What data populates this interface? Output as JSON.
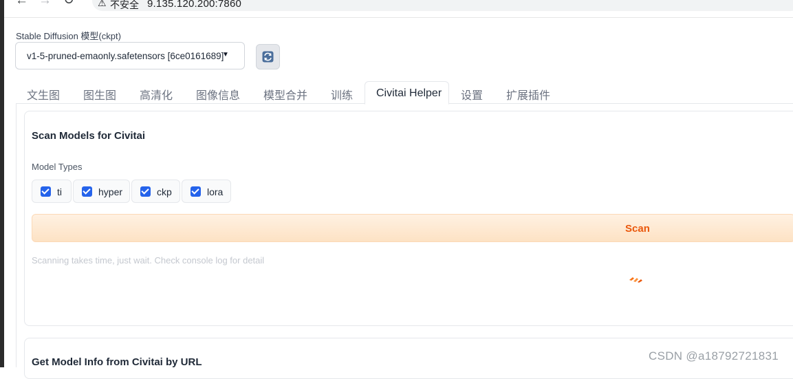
{
  "browser": {
    "security_label": "不安全",
    "url": "9.135.120.200:7860"
  },
  "checkpoint": {
    "label": "Stable Diffusion 模型(ckpt)",
    "value": "v1-5-pruned-emaonly.safetensors [6ce0161689]"
  },
  "tabs": [
    {
      "label": "文生图"
    },
    {
      "label": "图生图"
    },
    {
      "label": "高清化"
    },
    {
      "label": "图像信息"
    },
    {
      "label": "模型合并"
    },
    {
      "label": "训练"
    },
    {
      "label": "Civitai Helper",
      "active": true
    },
    {
      "label": "设置"
    },
    {
      "label": "扩展插件"
    }
  ],
  "scan_section": {
    "title": "Scan Models for Civitai",
    "types_label": "Model Types",
    "types": [
      {
        "label": "ti",
        "checked": true
      },
      {
        "label": "hyper",
        "checked": true
      },
      {
        "label": "ckp",
        "checked": true
      },
      {
        "label": "lora",
        "checked": true
      }
    ],
    "button_label": "Scan",
    "hint": "Scanning takes time, just wait. Check console log for detail"
  },
  "url_section": {
    "title": "Get Model Info from Civitai by URL"
  },
  "watermark": "CSDN @a18792721831",
  "colors": {
    "accent_orange": "#ea580c",
    "checkbox_blue": "#2563eb"
  }
}
